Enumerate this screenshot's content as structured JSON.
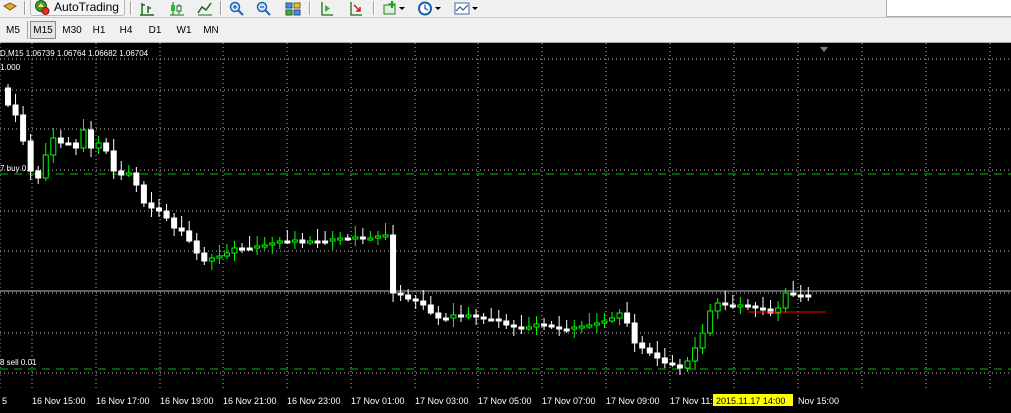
{
  "toolbar": {
    "autotrading_label": "AutoTrading",
    "icons": [
      "open-folder",
      "autotrading",
      "bar-chart",
      "candlestick-chart",
      "line-chart",
      "zoom-in",
      "zoom-out",
      "tile-windows",
      "chart-shift",
      "autoscroll",
      "new-order",
      "periods",
      "templates"
    ]
  },
  "timeframes": [
    "M5",
    "M15",
    "M30",
    "H1",
    "H4",
    "D1",
    "W1",
    "MN"
  ],
  "active_timeframe": "M15",
  "chart": {
    "info_line": "D,M15  1.06739 1.06764 1.06682 1.06704",
    "scale_label": "1.000",
    "buy_label": "7 buy 0.0",
    "sell_label": "8 sell 0.01",
    "time_labels": [
      "5",
      "16 Nov 15:00",
      "16 Nov 17:00",
      "16 Nov 19:00",
      "16 Nov 21:00",
      "16 Nov 23:00",
      "17 Nov 01:00",
      "17 Nov 03:00",
      "17 Nov 05:00",
      "17 Nov 07:00",
      "17 Nov 09:00",
      "17 Nov 11:00",
      "2015.11.17 14:00",
      "Nov 15:00"
    ],
    "crosshair_label": "2015.11.17 14:00",
    "colors": {
      "background": "#000000",
      "grid": "#ffffff",
      "bull": "#00ff00",
      "bear": "#ffffff",
      "order_line": "#00c000",
      "bid_line": "#c0c0c0",
      "ask_line": "#ff0000",
      "crosshair_bg": "#ffff00"
    }
  }
}
